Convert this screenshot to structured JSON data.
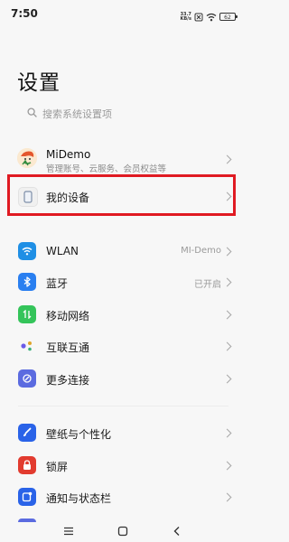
{
  "status": {
    "time": "7:50",
    "net_speed_value": "33.7",
    "net_speed_unit": "KB/s",
    "battery": "62"
  },
  "page": {
    "title": "设置"
  },
  "search": {
    "placeholder": "搜索系统设置项"
  },
  "account": {
    "name": "MiDemo",
    "subtitle": "管理账号、云服务、会员权益等"
  },
  "device": {
    "label": "我的设备"
  },
  "network_group": [
    {
      "label": "WLAN",
      "value": "MI-Demo",
      "color": "#1f8fe5",
      "icon": "wifi-icon"
    },
    {
      "label": "蓝牙",
      "value": "已开启",
      "color": "#2a7ff0",
      "icon": "bluetooth-icon"
    },
    {
      "label": "移动网络",
      "value": "",
      "color": "#34c45a",
      "icon": "mobile-data-icon"
    },
    {
      "label": "互联互通",
      "value": "",
      "color": "#ffffff",
      "icon": "connectivity-icon"
    },
    {
      "label": "更多连接",
      "value": "",
      "color": "#5b6be0",
      "icon": "link-icon"
    }
  ],
  "personal_group": [
    {
      "label": "壁纸与个性化",
      "color": "#2a63e8",
      "icon": "brush-icon"
    },
    {
      "label": "锁屏",
      "color": "#e23b2f",
      "icon": "lock-icon"
    },
    {
      "label": "通知与状态栏",
      "color": "#2a63e8",
      "icon": "notification-icon"
    }
  ],
  "highlight_color": "#e01a22"
}
